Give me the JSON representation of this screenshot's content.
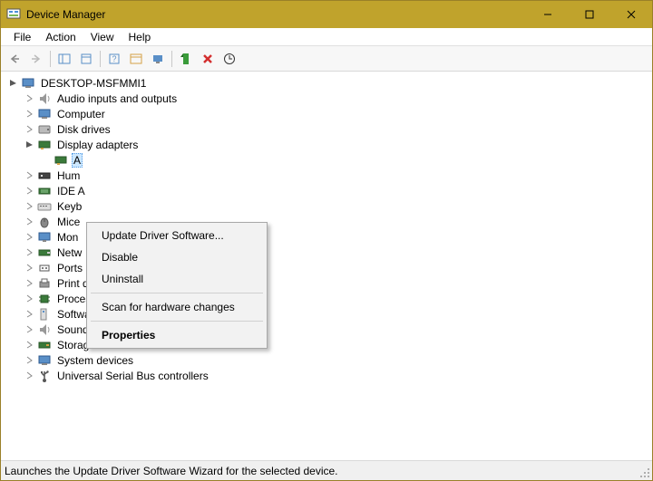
{
  "window": {
    "title": "Device Manager"
  },
  "menu": {
    "file": "File",
    "action": "Action",
    "view": "View",
    "help": "Help"
  },
  "tree": {
    "root": "DESKTOP-MSFMMI1",
    "items": [
      {
        "label": "Audio inputs and outputs",
        "expanded": false
      },
      {
        "label": "Computer",
        "expanded": false
      },
      {
        "label": "Disk drives",
        "expanded": false
      },
      {
        "label": "Display adapters",
        "expanded": true
      },
      {
        "label": "Human Interface Devices",
        "expanded": false
      },
      {
        "label": "IDE ATA/ATAPI controllers",
        "expanded": false
      },
      {
        "label": "Keyboards",
        "expanded": false
      },
      {
        "label": "Mice and other pointing devices",
        "expanded": false
      },
      {
        "label": "Monitors",
        "expanded": false
      },
      {
        "label": "Network adapters",
        "expanded": false
      },
      {
        "label": "Ports (COM & LPT)",
        "expanded": false
      },
      {
        "label": "Print queues",
        "expanded": false
      },
      {
        "label": "Processors",
        "expanded": false
      },
      {
        "label": "Software devices",
        "expanded": false
      },
      {
        "label": "Sound, video and game controllers",
        "expanded": false
      },
      {
        "label": "Storage controllers",
        "expanded": false
      },
      {
        "label": "System devices",
        "expanded": false
      },
      {
        "label": "Universal Serial Bus controllers",
        "expanded": false
      }
    ],
    "display_child_visible": "A",
    "truncated": {
      "human": "Hum",
      "ide": "IDE A",
      "keyb": "Keyb",
      "mice": "Mice",
      "mon": "Mon",
      "netw": "Netw"
    }
  },
  "context_menu": {
    "update": "Update Driver Software...",
    "disable": "Disable",
    "uninstall": "Uninstall",
    "scan": "Scan for hardware changes",
    "properties": "Properties"
  },
  "status": {
    "text": "Launches the Update Driver Software Wizard for the selected device."
  }
}
